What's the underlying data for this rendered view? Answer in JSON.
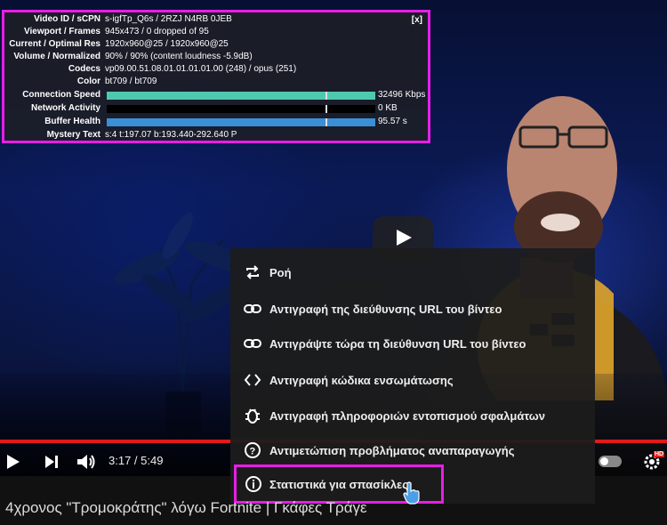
{
  "stats": {
    "close_label": "[x]",
    "rows": [
      {
        "label": "Video ID / sCPN",
        "value": "s-igfTp_Q6s / 2RZJ N4RB 0JEB"
      },
      {
        "label": "Viewport / Frames",
        "value": "945x473 / 0 dropped of 95"
      },
      {
        "label": "Current / Optimal Res",
        "value": "1920x960@25 / 1920x960@25"
      },
      {
        "label": "Volume / Normalized",
        "value": "90% / 90% (content loudness -5.9dB)"
      },
      {
        "label": "Codecs",
        "value": "vp09.00.51.08.01.01.01.01.00 (248) / opus (251)"
      },
      {
        "label": "Color",
        "value": "bt709 / bt709"
      }
    ],
    "connection_speed": {
      "label": "Connection Speed",
      "value": "32496 Kbps",
      "color": "#4ec9b0"
    },
    "network_activity": {
      "label": "Network Activity",
      "value": "0 KB"
    },
    "buffer_health": {
      "label": "Buffer Health",
      "value": "95.57 s",
      "color": "#3a8fd6"
    },
    "mystery_text": {
      "label": "Mystery Text",
      "value": "s:4 t:197.07 b:193.440-292.640 P"
    }
  },
  "menu": {
    "items": [
      {
        "icon": "loop-icon",
        "label": "Ροή"
      },
      {
        "icon": "link-icon",
        "label": "Αντιγραφή της διεύθυνσης URL του βίντεο"
      },
      {
        "icon": "link-icon",
        "label": "Αντιγράψτε τώρα τη διεύθυνση URL του βίντεο"
      },
      {
        "icon": "embed-code-icon",
        "label": "Αντιγραφή κώδικα ενσωμάτωσης"
      },
      {
        "icon": "bug-icon",
        "label": "Αντιγραφή πληροφοριών εντοπισμού σφαλμάτων"
      },
      {
        "icon": "help-icon",
        "label": "Αντιμετώπιση προβλήματος αναπαραγωγής"
      },
      {
        "icon": "info-icon",
        "label": "Στατιστικά για σπασίκλες"
      }
    ]
  },
  "player": {
    "time": "3:17 / 5:49",
    "hd_badge": "HD",
    "accent": "#e01a1a",
    "highlight": "#e61fe6"
  },
  "video_title": "4χρονος \"Τρομοκράτης\" λόγω Fortnite | Γκάφες Τράγε"
}
